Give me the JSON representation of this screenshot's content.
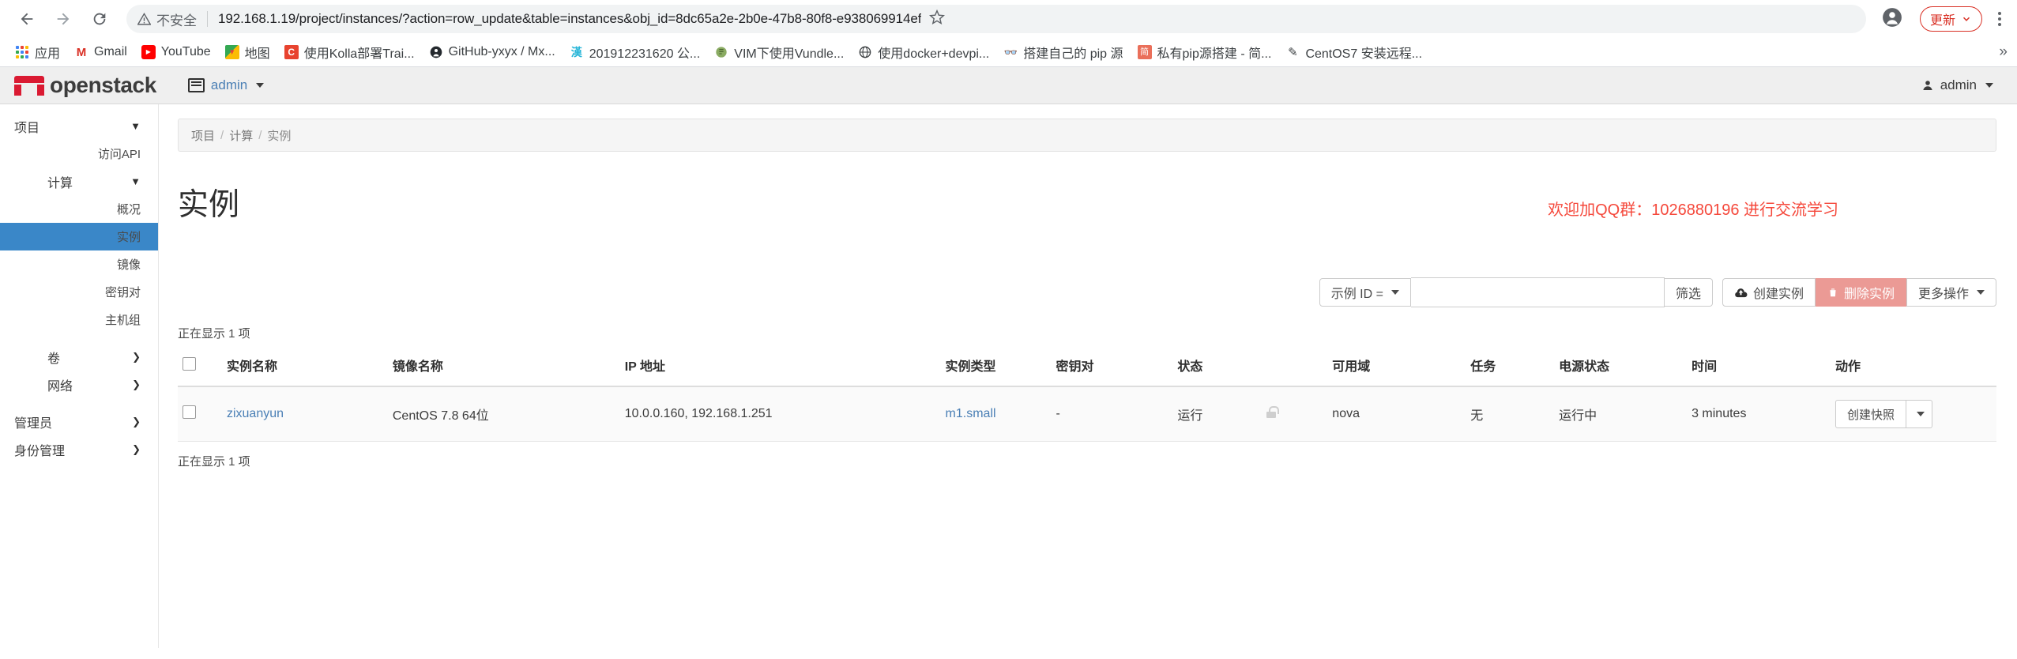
{
  "browser": {
    "back_icon": "back-arrow-icon",
    "forward_icon": "forward-arrow-icon",
    "reload_icon": "reload-icon",
    "security_label": "不安全",
    "url": "192.168.1.19/project/instances/?action=row_update&table=instances&obj_id=8dc65a2e-2b0e-47b8-80f8-e938069914ef",
    "star_icon": "bookmark-star-icon",
    "profile_icon": "profile-avatar-icon",
    "update_label": "更新",
    "menu_icon": "three-dot-menu-icon",
    "overflow_label": "»",
    "bookmarks": [
      {
        "label": "应用",
        "icon": "apps-grid-icon"
      },
      {
        "label": "Gmail",
        "icon": "gmail-icon",
        "glyph": "M",
        "color": "#d93025"
      },
      {
        "label": "YouTube",
        "icon": "youtube-icon",
        "glyph": "▶",
        "color": "#ff0000"
      },
      {
        "label": "地图",
        "icon": "google-maps-icon",
        "glyph": "📍",
        "color": "#34a853"
      },
      {
        "label": "使用Kolla部署Trai...",
        "icon": "csdn-icon",
        "glyph": "C",
        "color": "#e8432f"
      },
      {
        "label": "GitHub-yxyx / Mx...",
        "icon": "github-icon",
        "glyph": "⬤",
        "color": "#24292e"
      },
      {
        "label": "201912231620 公...",
        "icon": "hanzi-icon",
        "glyph": "漢",
        "color": "#29b6d8"
      },
      {
        "label": "VIM下使用Vundle...",
        "icon": "vim-icon",
        "glyph": "⬢",
        "color": "#7d9b53"
      },
      {
        "label": "使用docker+devpi...",
        "icon": "globe-icon",
        "glyph": "🌐",
        "color": "#2f2f2f"
      },
      {
        "label": "搭建自己的 pip 源",
        "icon": "mask-icon",
        "glyph": "👓",
        "color": "#5f6368"
      },
      {
        "label": "私有pip源搭建 - 简...",
        "icon": "jianshu-icon",
        "glyph": "简",
        "color": "#ea6f5a"
      },
      {
        "label": "CentOS7 安装远程...",
        "icon": "pencil-icon",
        "glyph": "✎",
        "color": "#3c4043"
      }
    ]
  },
  "header": {
    "brand": "openstack",
    "brand_mark_color": "#da1a32",
    "tenant_icon": "tenant-list-icon",
    "tenant_label": "admin",
    "user_icon": "user-icon",
    "user_label": "admin"
  },
  "sidebar": {
    "items": [
      {
        "label": "项目",
        "level": 0,
        "type": "group",
        "chevron": "▼",
        "active": false
      },
      {
        "label": "访问API",
        "level": 1,
        "type": "item",
        "active": false
      },
      {
        "label": "计算",
        "level": 1,
        "type": "group",
        "chevron": "▼",
        "active": false
      },
      {
        "label": "概况",
        "level": 2,
        "type": "item",
        "active": false
      },
      {
        "label": "实例",
        "level": 2,
        "type": "item",
        "active": true
      },
      {
        "label": "镜像",
        "level": 2,
        "type": "item",
        "active": false
      },
      {
        "label": "密钥对",
        "level": 2,
        "type": "item",
        "active": false
      },
      {
        "label": "主机组",
        "level": 2,
        "type": "item",
        "active": false
      },
      {
        "label": "卷",
        "level": 1,
        "type": "group",
        "chevron": "❯",
        "active": false
      },
      {
        "label": "网络",
        "level": 1,
        "type": "group",
        "chevron": "❯",
        "active": false
      },
      {
        "label": "管理员",
        "level": 0,
        "type": "group",
        "chevron": "❯",
        "active": false
      },
      {
        "label": "身份管理",
        "level": 0,
        "type": "group",
        "chevron": "❯",
        "active": false
      }
    ]
  },
  "breadcrumb": {
    "items": [
      "项目",
      "计算",
      "实例"
    ],
    "separator": "/"
  },
  "page": {
    "title": "实例",
    "promo": "欢迎加QQ群：1026880196 进行交流学习",
    "promo_color": "#f5483b"
  },
  "toolbar": {
    "filter_select_label": "示例 ID =",
    "search_value": "",
    "search_placeholder": "",
    "filter_button": "筛选",
    "create_button": "创建实例",
    "create_icon": "cloud-upload-icon",
    "delete_button": "删除实例",
    "delete_icon": "trash-icon",
    "delete_color": "#eb9a95",
    "more_button": "更多操作"
  },
  "table": {
    "count_top": "正在显示 1 项",
    "count_bottom": "正在显示 1 项",
    "columns": [
      "",
      "实例名称",
      "镜像名称",
      "IP 地址",
      "实例类型",
      "密钥对",
      "状态",
      "",
      "可用域",
      "任务",
      "电源状态",
      "时间",
      "动作"
    ],
    "rows": [
      {
        "name": "zixuanyun",
        "image": "CentOS 7.8 64位",
        "ip": "10.0.0.160, 192.168.1.251",
        "flavor": "m1.small",
        "keypair": "-",
        "status": "运行",
        "lock_icon": "unlocked-padlock-icon",
        "az": "nova",
        "task": "无",
        "power": "运行中",
        "time": "3 minutes",
        "action_label": "创建快照",
        "action_caret_icon": "chevron-down-icon"
      }
    ]
  }
}
